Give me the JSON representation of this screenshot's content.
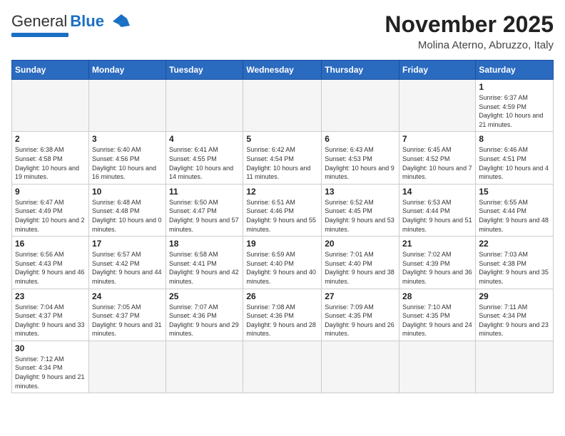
{
  "header": {
    "logo_general": "General",
    "logo_blue": "Blue",
    "month": "November 2025",
    "location": "Molina Aterno, Abruzzo, Italy"
  },
  "weekdays": [
    "Sunday",
    "Monday",
    "Tuesday",
    "Wednesday",
    "Thursday",
    "Friday",
    "Saturday"
  ],
  "days": {
    "d1": {
      "num": "1",
      "info": "Sunrise: 6:37 AM\nSunset: 4:59 PM\nDaylight: 10 hours and 21 minutes."
    },
    "d2": {
      "num": "2",
      "info": "Sunrise: 6:38 AM\nSunset: 4:58 PM\nDaylight: 10 hours and 19 minutes."
    },
    "d3": {
      "num": "3",
      "info": "Sunrise: 6:40 AM\nSunset: 4:56 PM\nDaylight: 10 hours and 16 minutes."
    },
    "d4": {
      "num": "4",
      "info": "Sunrise: 6:41 AM\nSunset: 4:55 PM\nDaylight: 10 hours and 14 minutes."
    },
    "d5": {
      "num": "5",
      "info": "Sunrise: 6:42 AM\nSunset: 4:54 PM\nDaylight: 10 hours and 11 minutes."
    },
    "d6": {
      "num": "6",
      "info": "Sunrise: 6:43 AM\nSunset: 4:53 PM\nDaylight: 10 hours and 9 minutes."
    },
    "d7": {
      "num": "7",
      "info": "Sunrise: 6:45 AM\nSunset: 4:52 PM\nDaylight: 10 hours and 7 minutes."
    },
    "d8": {
      "num": "8",
      "info": "Sunrise: 6:46 AM\nSunset: 4:51 PM\nDaylight: 10 hours and 4 minutes."
    },
    "d9": {
      "num": "9",
      "info": "Sunrise: 6:47 AM\nSunset: 4:49 PM\nDaylight: 10 hours and 2 minutes."
    },
    "d10": {
      "num": "10",
      "info": "Sunrise: 6:48 AM\nSunset: 4:48 PM\nDaylight: 10 hours and 0 minutes."
    },
    "d11": {
      "num": "11",
      "info": "Sunrise: 6:50 AM\nSunset: 4:47 PM\nDaylight: 9 hours and 57 minutes."
    },
    "d12": {
      "num": "12",
      "info": "Sunrise: 6:51 AM\nSunset: 4:46 PM\nDaylight: 9 hours and 55 minutes."
    },
    "d13": {
      "num": "13",
      "info": "Sunrise: 6:52 AM\nSunset: 4:45 PM\nDaylight: 9 hours and 53 minutes."
    },
    "d14": {
      "num": "14",
      "info": "Sunrise: 6:53 AM\nSunset: 4:44 PM\nDaylight: 9 hours and 51 minutes."
    },
    "d15": {
      "num": "15",
      "info": "Sunrise: 6:55 AM\nSunset: 4:44 PM\nDaylight: 9 hours and 48 minutes."
    },
    "d16": {
      "num": "16",
      "info": "Sunrise: 6:56 AM\nSunset: 4:43 PM\nDaylight: 9 hours and 46 minutes."
    },
    "d17": {
      "num": "17",
      "info": "Sunrise: 6:57 AM\nSunset: 4:42 PM\nDaylight: 9 hours and 44 minutes."
    },
    "d18": {
      "num": "18",
      "info": "Sunrise: 6:58 AM\nSunset: 4:41 PM\nDaylight: 9 hours and 42 minutes."
    },
    "d19": {
      "num": "19",
      "info": "Sunrise: 6:59 AM\nSunset: 4:40 PM\nDaylight: 9 hours and 40 minutes."
    },
    "d20": {
      "num": "20",
      "info": "Sunrise: 7:01 AM\nSunset: 4:40 PM\nDaylight: 9 hours and 38 minutes."
    },
    "d21": {
      "num": "21",
      "info": "Sunrise: 7:02 AM\nSunset: 4:39 PM\nDaylight: 9 hours and 36 minutes."
    },
    "d22": {
      "num": "22",
      "info": "Sunrise: 7:03 AM\nSunset: 4:38 PM\nDaylight: 9 hours and 35 minutes."
    },
    "d23": {
      "num": "23",
      "info": "Sunrise: 7:04 AM\nSunset: 4:37 PM\nDaylight: 9 hours and 33 minutes."
    },
    "d24": {
      "num": "24",
      "info": "Sunrise: 7:05 AM\nSunset: 4:37 PM\nDaylight: 9 hours and 31 minutes."
    },
    "d25": {
      "num": "25",
      "info": "Sunrise: 7:07 AM\nSunset: 4:36 PM\nDaylight: 9 hours and 29 minutes."
    },
    "d26": {
      "num": "26",
      "info": "Sunrise: 7:08 AM\nSunset: 4:36 PM\nDaylight: 9 hours and 28 minutes."
    },
    "d27": {
      "num": "27",
      "info": "Sunrise: 7:09 AM\nSunset: 4:35 PM\nDaylight: 9 hours and 26 minutes."
    },
    "d28": {
      "num": "28",
      "info": "Sunrise: 7:10 AM\nSunset: 4:35 PM\nDaylight: 9 hours and 24 minutes."
    },
    "d29": {
      "num": "29",
      "info": "Sunrise: 7:11 AM\nSunset: 4:34 PM\nDaylight: 9 hours and 23 minutes."
    },
    "d30": {
      "num": "30",
      "info": "Sunrise: 7:12 AM\nSunset: 4:34 PM\nDaylight: 9 hours and 21 minutes."
    }
  }
}
